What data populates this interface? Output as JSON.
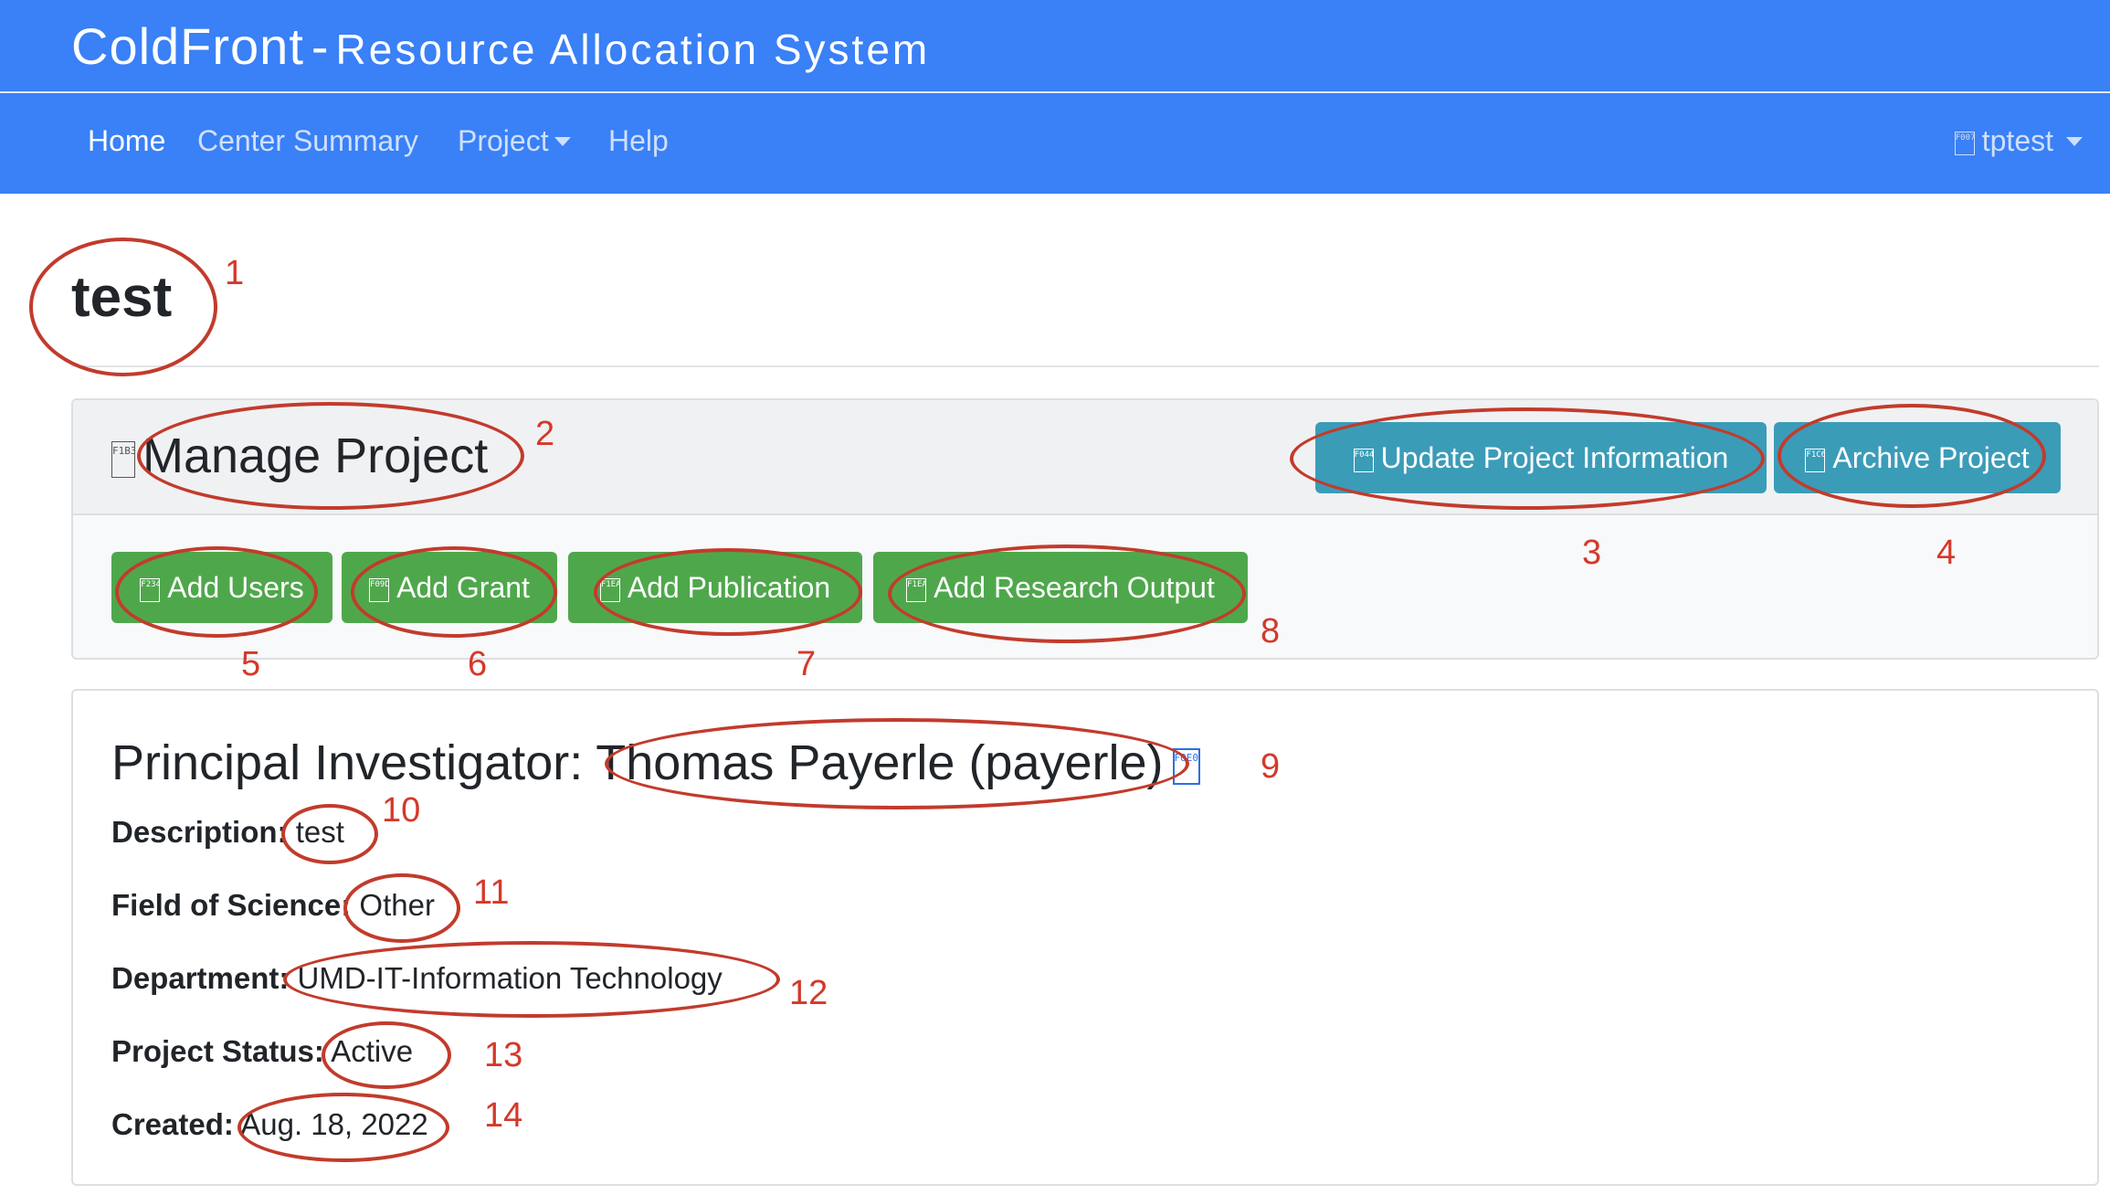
{
  "header": {
    "brand_name": "ColdFront",
    "brand_dash": "-",
    "brand_subtitle": "Resource Allocation System"
  },
  "nav": {
    "items": [
      {
        "label": "Home",
        "active": true
      },
      {
        "label": "Center Summary",
        "active": false
      },
      {
        "label": "Project",
        "active": false,
        "dropdown": true
      },
      {
        "label": "Help",
        "active": false
      }
    ],
    "user": {
      "icon_text": "F007",
      "label": "tptest"
    }
  },
  "page": {
    "title": "test"
  },
  "manage": {
    "icon_text": "F1B3",
    "title": "Manage Project",
    "update_button": {
      "icon_text": "F044",
      "label": "Update Project Information"
    },
    "archive_button": {
      "icon_text": "F1C6",
      "label": "Archive Project"
    },
    "add_users": {
      "icon_text": "F234",
      "label": "Add Users"
    },
    "add_grant": {
      "icon_text": "F09D",
      "label": "Add Grant"
    },
    "add_publication": {
      "icon_text": "F1EA",
      "label": "Add Publication"
    },
    "add_research_output": {
      "icon_text": "F1EA",
      "label": "Add Research Output"
    }
  },
  "project": {
    "pi_label": "Principal Investigator:",
    "pi_name": "Thomas Payerle (payerle)",
    "pi_icon_text": "F0E0",
    "description_label": "Description:",
    "description": "test",
    "field_label": "Field of Science:",
    "field": "Other",
    "department_label": "Department:",
    "department": "UMD-IT-Information Technology",
    "status_label": "Project Status:",
    "status": "Active",
    "created_label": "Created:",
    "created": "Aug. 18, 2022"
  },
  "annotations": [
    "1",
    "2",
    "3",
    "4",
    "5",
    "6",
    "7",
    "8",
    "9",
    "10",
    "11",
    "12",
    "13",
    "14"
  ],
  "colors": {
    "navbar": "#3a80f6",
    "btn_info": "#3b9cb8",
    "btn_success": "#4fa74c",
    "annotation": "#c23b2c"
  }
}
